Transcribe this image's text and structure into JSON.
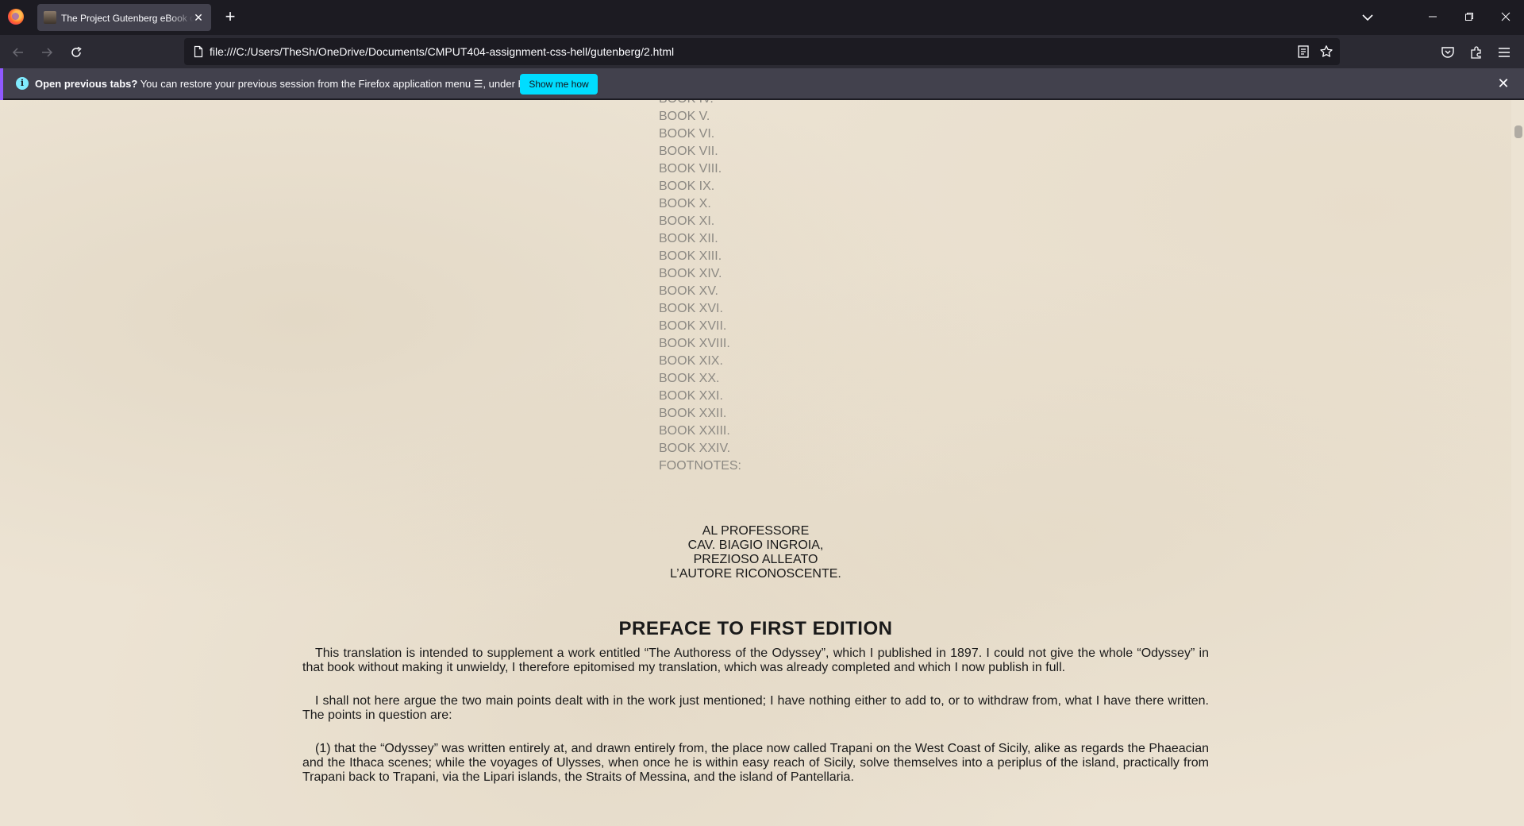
{
  "browser": {
    "tab_title": "The Project Gutenberg eBook of",
    "url": "file:///C:/Users/TheSh/OneDrive/Documents/CMPUT404-assignment-css-hell/gutenberg/2.html"
  },
  "notification": {
    "bold_text": "Open previous tabs?",
    "text": "You can restore your previous session from the Firefox application menu ☰, under History.",
    "button_label": "Show me how"
  },
  "toc": [
    "BOOK V.",
    "BOOK VI.",
    "BOOK VII.",
    "BOOK VIII.",
    "BOOK IX.",
    "BOOK X.",
    "BOOK XI.",
    "BOOK XII.",
    "BOOK XIII.",
    "BOOK XIV.",
    "BOOK XV.",
    "BOOK XVI.",
    "BOOK XVII.",
    "BOOK XVIII.",
    "BOOK XIX.",
    "BOOK XX.",
    "BOOK XXI.",
    "BOOK XXII.",
    "BOOK XXIII.",
    "BOOK XXIV.",
    "FOOTNOTES:"
  ],
  "toc_partial": "BOOK IV.",
  "dedication": [
    "AL PROFESSORE",
    "CAV. BIAGIO INGROIA,",
    "PREZIOSO ALLEATO",
    "L’AUTORE RICONOSCENTE."
  ],
  "preface": {
    "title": "PREFACE TO FIRST EDITION",
    "paragraphs": [
      "This translation is intended to supplement a work entitled “The Authoress of the Odyssey”, which I published in 1897. I could not give the whole “Odyssey” in that book without making it unwieldy, I therefore epitomised my translation, which was already completed and which I now publish in full.",
      "I shall not here argue the two main points dealt with in the work just mentioned; I have nothing either to add to, or to withdraw from, what I have there written. The points in question are:",
      "(1) that the “Odyssey” was written entirely at, and drawn entirely from, the place now called Trapani on the West Coast of Sicily, alike as regards the Phaeacian and the Ithaca scenes; while the voyages of Ulysses, when once he is within easy reach of Sicily, solve themselves into a periplus of the island, practically from Trapani back to Trapani, via the Lipari islands, the Straits of Messina, and the island of Pantellaria."
    ]
  }
}
